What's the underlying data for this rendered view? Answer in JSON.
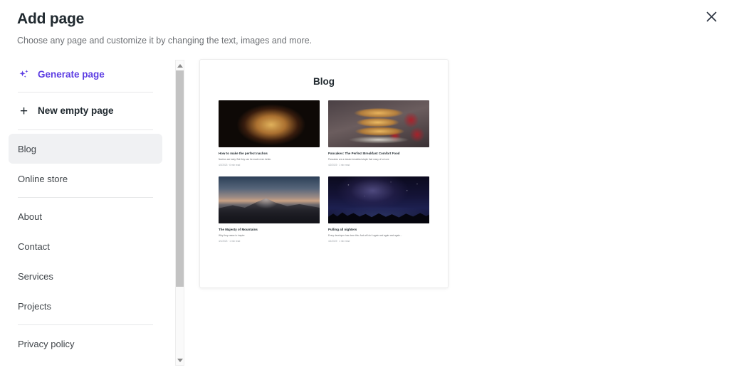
{
  "header": {
    "title": "Add page",
    "subtitle": "Choose any page and customize it by changing the text, images and more.",
    "close_icon": "close-icon"
  },
  "sidebar": {
    "generate": {
      "label": "Generate page",
      "icon": "sparkle-icon",
      "color": "#5E3FE3"
    },
    "new_page": {
      "label": "New empty page",
      "icon": "plus-icon"
    },
    "items": [
      {
        "label": "Blog",
        "selected": true
      },
      {
        "label": "Online store",
        "selected": false
      },
      {
        "label": "About",
        "selected": false
      },
      {
        "label": "Contact",
        "selected": false
      },
      {
        "label": "Services",
        "selected": false
      },
      {
        "label": "Projects",
        "selected": false
      },
      {
        "label": "Privacy policy",
        "selected": false
      }
    ],
    "scrollbar": {
      "up_icon": "chevron-up-icon",
      "down_icon": "chevron-down-icon"
    }
  },
  "preview": {
    "title": "Blog",
    "posts": [
      {
        "title": "How to make the perfect nachos",
        "description": "Nachos are tasty. But they can be made even better.",
        "meta": "4/2/2023 · 6 min read",
        "image": "nachos-photo"
      },
      {
        "title": "Pancakes: The Perfect Breakfast Comfort Food",
        "description": "Pancakes are a classic breakfast staple that many of us love.",
        "meta": "4/2/2023 · 1 min read",
        "image": "pancakes-photo"
      },
      {
        "title": "The Majesty of Mountains",
        "description": "Why they cease to inspire",
        "meta": "4/1/2023 · 1 min read",
        "image": "mountains-photo"
      },
      {
        "title": "Pulling all nighters",
        "description": "Every developer has done this. And will do it again and again and again...",
        "meta": "4/1/2023 · 1 min read",
        "image": "night-sky-photo"
      }
    ]
  }
}
